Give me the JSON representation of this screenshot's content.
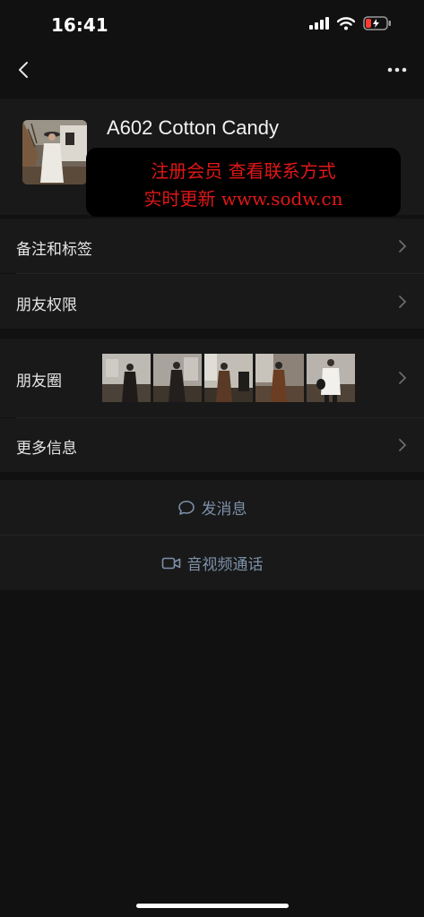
{
  "status_bar": {
    "time": "16:41"
  },
  "profile": {
    "name": "A602 Cotton Candy"
  },
  "watermark": {
    "line1": "注册会员 查看联系方式",
    "line2": "实时更新 www.sodw.cn"
  },
  "rows": {
    "remarks": "备注和标签",
    "permissions": "朋友权限",
    "moments": "朋友圈",
    "more_info": "更多信息"
  },
  "actions": {
    "message": "发消息",
    "call": "音视频通话"
  },
  "colors": {
    "background": "#111111",
    "cell": "#191919",
    "action_text": "#7d90a9",
    "watermark_text": "#e01717"
  },
  "icons": [
    "back-icon",
    "more-icon",
    "chevron-right-icon",
    "chat-bubble-icon",
    "video-camera-icon",
    "signal-icon",
    "wifi-icon",
    "battery-icon"
  ]
}
